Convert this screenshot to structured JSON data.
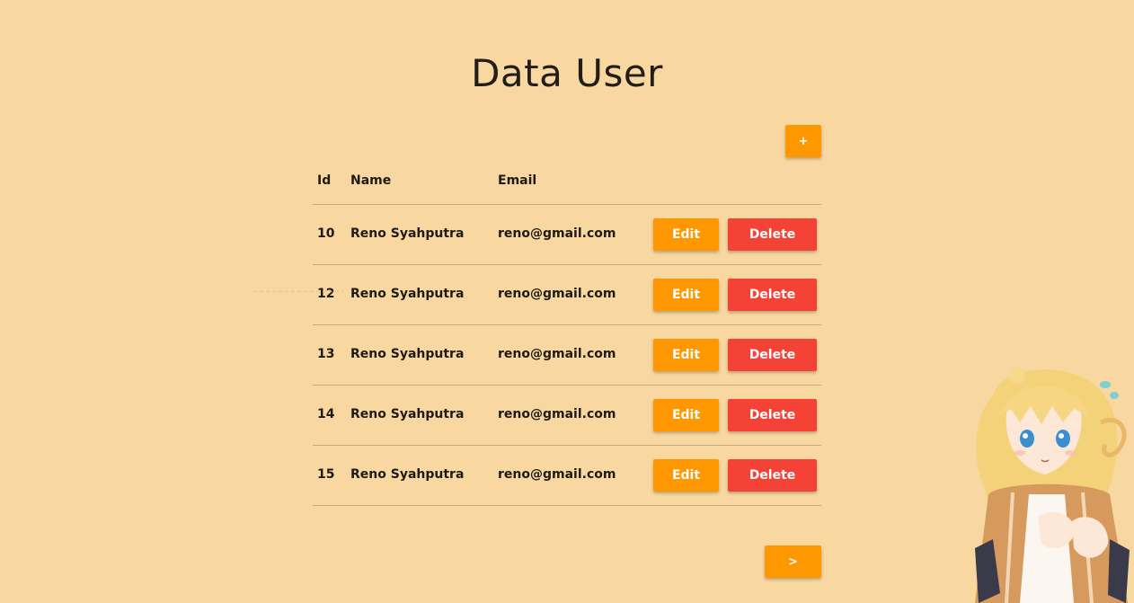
{
  "page": {
    "title": "Data User"
  },
  "toolbar": {
    "add_label": "+"
  },
  "table": {
    "headers": {
      "id": "Id",
      "name": "Name",
      "email": "Email"
    },
    "rows": [
      {
        "id": "10",
        "name": "Reno Syahputra",
        "email": "reno@gmail.com",
        "edit_label": "Edit",
        "delete_label": "Delete"
      },
      {
        "id": "12",
        "name": "Reno Syahputra",
        "email": "reno@gmail.com",
        "edit_label": "Edit",
        "delete_label": "Delete"
      },
      {
        "id": "13",
        "name": "Reno Syahputra",
        "email": "reno@gmail.com",
        "edit_label": "Edit",
        "delete_label": "Delete"
      },
      {
        "id": "14",
        "name": "Reno Syahputra",
        "email": "reno@gmail.com",
        "edit_label": "Edit",
        "delete_label": "Delete"
      },
      {
        "id": "15",
        "name": "Reno Syahputra",
        "email": "reno@gmail.com",
        "edit_label": "Edit",
        "delete_label": "Delete"
      }
    ]
  },
  "pagination": {
    "next_label": ">"
  },
  "colors": {
    "background": "#f8d7a0",
    "accent_orange": "#ff9800",
    "danger_red": "#f44336",
    "text": "#221d17"
  },
  "icons": {
    "mascot": "anime-girl-mascot-illustration"
  }
}
